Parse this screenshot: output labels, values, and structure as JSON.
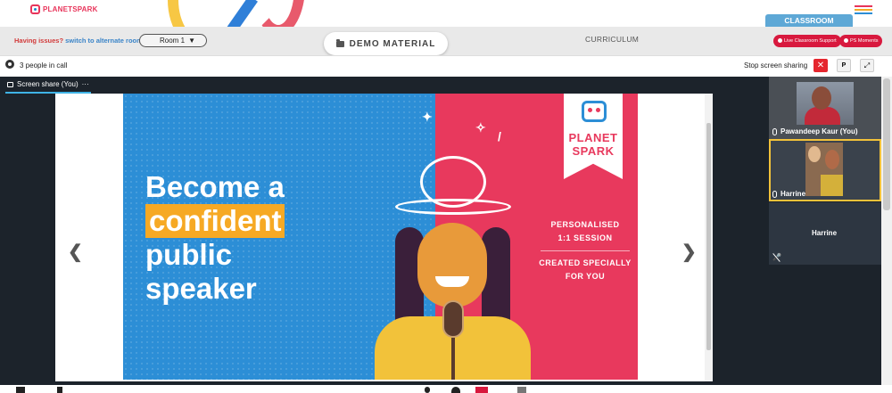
{
  "brand": {
    "logo_text": "PLANETSPARK",
    "accent": "#e8345a",
    "blue": "#2c8ed6"
  },
  "header": {
    "classroom_tab": "CLASSROOM",
    "menu_icon": "hamburger-icon"
  },
  "toolbar": {
    "issues_label": "Having issues?",
    "switch_link": "switch to alternate room",
    "room_select": "Room 1",
    "demo_material": "DEMO MATERIAL",
    "curriculum": "CURRICULUM",
    "live_support": "Live Classroom Support",
    "ps_moments": "PS Moments"
  },
  "call": {
    "people_count": "3 people in call",
    "stop_sharing": "Stop screen sharing",
    "p_label": "P"
  },
  "stage": {
    "tab_label": "Screen share (You)",
    "more": "···",
    "prev": "❮",
    "next": "❯"
  },
  "slide": {
    "line1": "Become a",
    "line2": "confident",
    "line3": "public",
    "line4": "speaker",
    "ribbon_line1": "PLANET",
    "ribbon_line2": "SPARK",
    "copy_line1": "PERSONALISED",
    "copy_line2": "1:1 SESSION",
    "copy_line3": "CREATED SPECIALLY",
    "copy_line4": "FOR YOU"
  },
  "participants": [
    {
      "name": "Pawandeep Kaur (You)"
    },
    {
      "name": "Harrine"
    },
    {
      "name": "Harrine"
    }
  ]
}
